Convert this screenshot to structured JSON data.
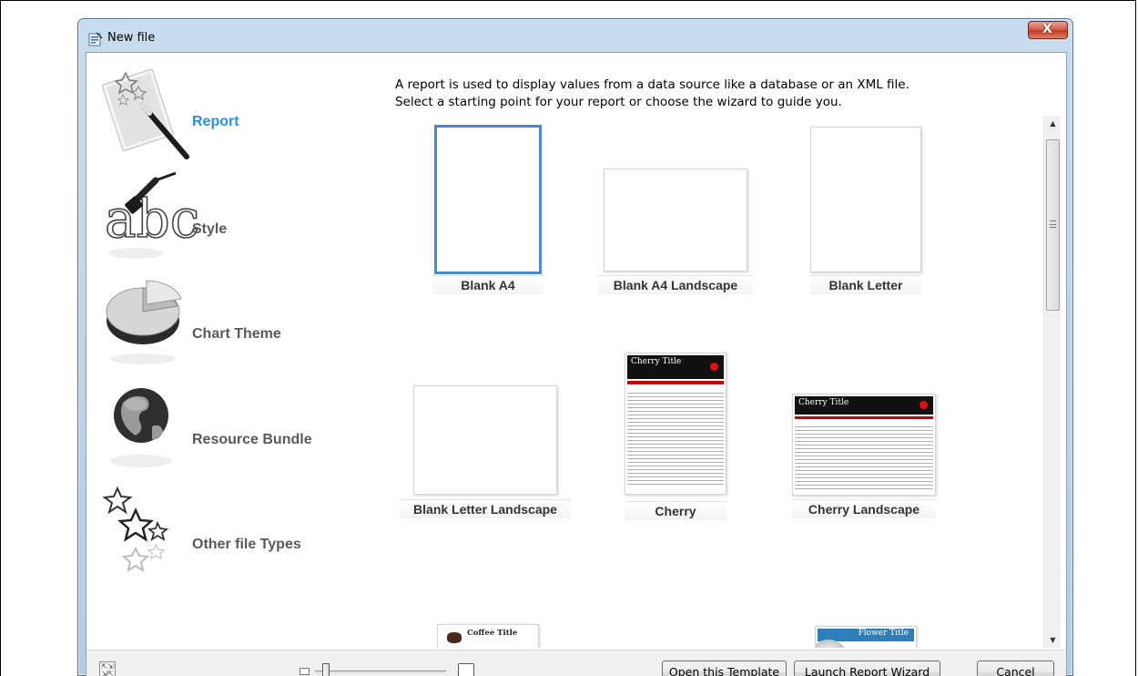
{
  "window": {
    "title": "New file",
    "close_glyph": "X"
  },
  "description": {
    "line1": "A report is used to display values from a data source like a database or an XML file.",
    "line2": "Select a starting point for your report or choose the wizard to guide you."
  },
  "sidebar": {
    "items": [
      {
        "label": "Report",
        "icon": "report-wand-icon",
        "active": true
      },
      {
        "label": "Style",
        "icon": "style-abc-brush-icon",
        "active": false
      },
      {
        "label": "Chart Theme",
        "icon": "pie-chart-icon",
        "active": false
      },
      {
        "label": "Resource Bundle",
        "icon": "globe-icon",
        "active": false
      },
      {
        "label": "Other file Types",
        "icon": "stars-icon",
        "active": false
      }
    ]
  },
  "templates": [
    {
      "label": "Blank A4",
      "selected": true
    },
    {
      "label": "Blank A4 Landscape",
      "selected": false
    },
    {
      "label": "Blank Letter",
      "selected": false
    },
    {
      "label": "Blank Letter Landscape",
      "selected": false
    },
    {
      "label": "Cherry",
      "selected": false,
      "preview_title": "Cherry Title"
    },
    {
      "label": "Cherry Landscape",
      "selected": false,
      "preview_title": "Cherry Title"
    },
    {
      "label": "",
      "selected": false,
      "preview_title": "Coffee Title"
    },
    {
      "label": "",
      "selected": false
    },
    {
      "label": "",
      "selected": false,
      "preview_title": "Flower Title"
    }
  ],
  "footer": {
    "open_template_label": "Open this Template",
    "launch_wizard_label": "Launch Report Wizard",
    "cancel_label": "Cancel"
  },
  "colors": {
    "accent_text": "#2e8fd2",
    "selection_border": "#4a86d9",
    "close_button": "#c23b23"
  }
}
